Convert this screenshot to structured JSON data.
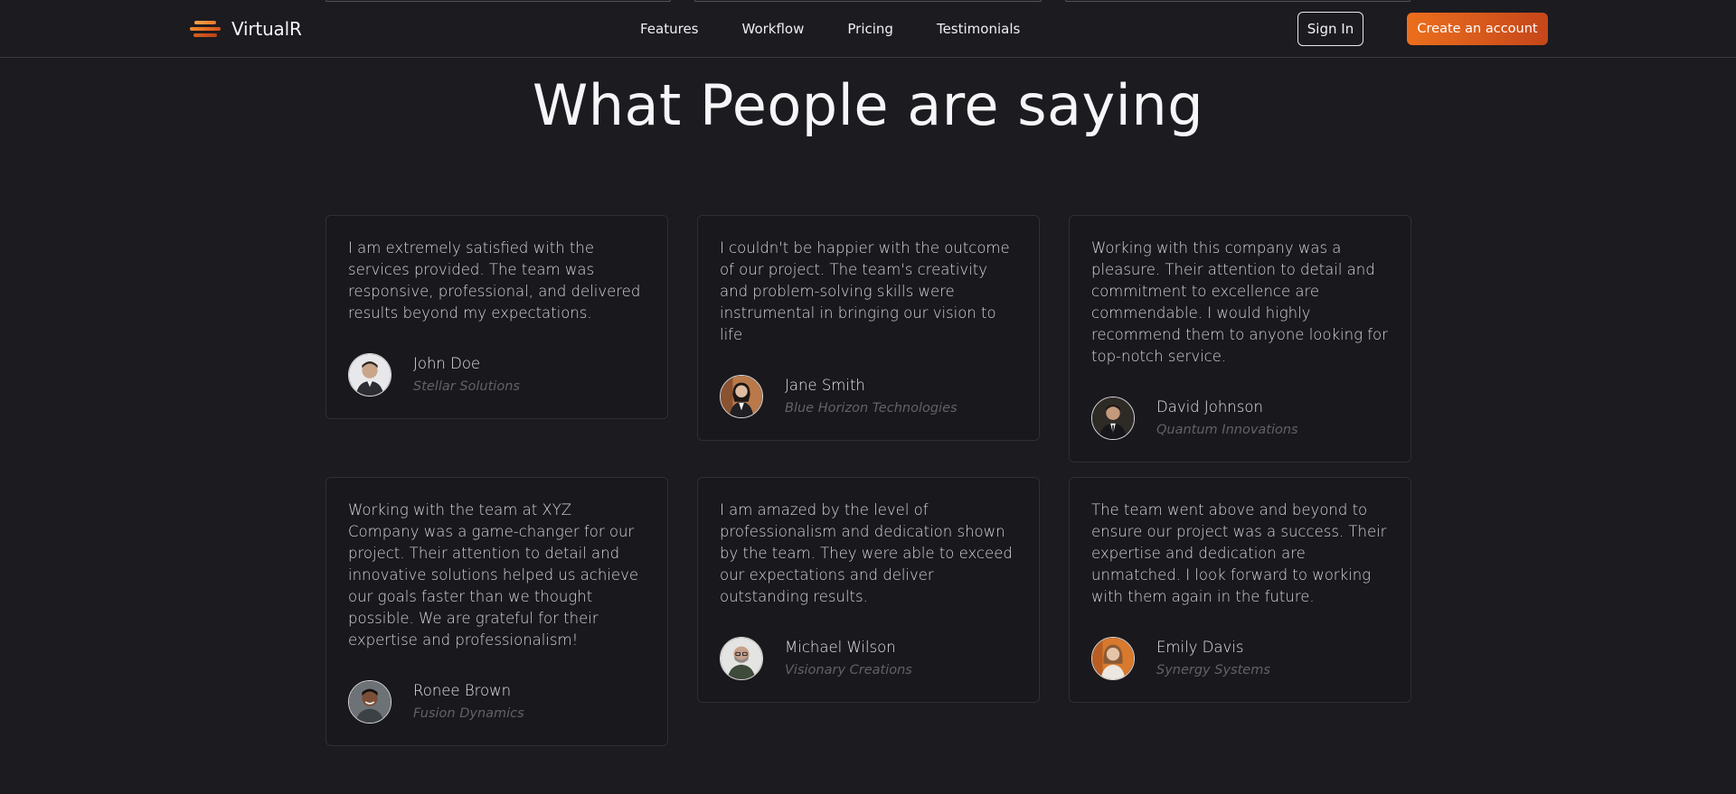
{
  "brand": {
    "name": "VirtualR",
    "logo_icon": "stacked-bars-logo"
  },
  "nav": {
    "links": [
      "Features",
      "Workflow",
      "Pricing",
      "Testimonials"
    ],
    "signin_label": "Sign In",
    "create_label": "Create an account"
  },
  "colors": {
    "background": "#1c1b20",
    "accent_start": "#ec6f1d",
    "accent_end": "#c5461a",
    "card": "#19181c",
    "company_text": "#626169"
  },
  "section": {
    "title": "What People are saying"
  },
  "testimonials": [
    {
      "quote": "I am extremely satisfied with the services provided. The team was responsive, professional, and delivered results beyond my expectations.",
      "name": "John Doe",
      "company": "Stellar Solutions"
    },
    {
      "quote": "I couldn't be happier with the outcome of our project. The team's creativity and problem-solving skills were instrumental in bringing our vision to life",
      "name": "Jane Smith",
      "company": "Blue Horizon Technologies"
    },
    {
      "quote": "Working with this company was a pleasure. Their attention to detail and commitment to excellence are commendable. I would highly recommend them to anyone looking for top-notch service.",
      "name": "David Johnson",
      "company": "Quantum Innovations"
    },
    {
      "quote": "Working with the team at XYZ Company was a game-changer for our project. Their attention to detail and innovative solutions helped us achieve our goals faster than we thought possible. We are grateful for their expertise and professionalism!",
      "name": "Ronee Brown",
      "company": "Fusion Dynamics"
    },
    {
      "quote": "I am amazed by the level of professionalism and dedication shown by the team. They were able to exceed our expectations and deliver outstanding results.",
      "name": "Michael Wilson",
      "company": "Visionary Creations"
    },
    {
      "quote": "The team went above and beyond to ensure our project was a success. Their expertise and dedication are unmatched. I look forward to working with them again in the future.",
      "name": "Emily Davis",
      "company": "Synergy Systems"
    }
  ]
}
